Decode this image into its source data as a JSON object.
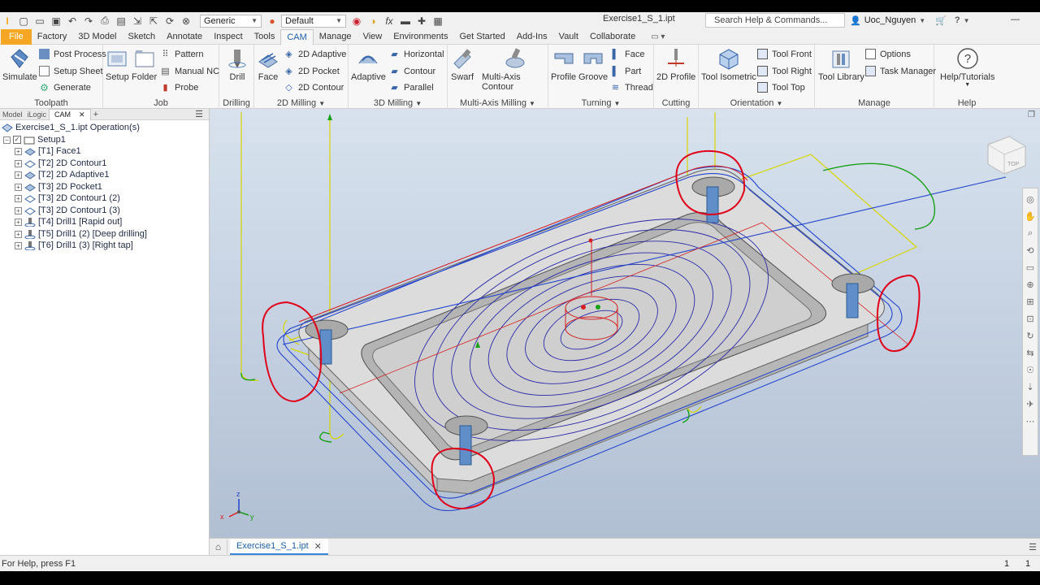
{
  "qat": {
    "material_value": "Generic",
    "appearance_value": "Default",
    "fx_label": "fx",
    "document_title": "Exercise1_S_1.ipt",
    "search_placeholder": "Search Help & Commands...",
    "user_name": "Uoc_Nguyen"
  },
  "menu": {
    "tabs": [
      "File",
      "Factory",
      "3D Model",
      "Sketch",
      "Annotate",
      "Inspect",
      "Tools",
      "CAM",
      "Manage",
      "View",
      "Environments",
      "Get Started",
      "Add-Ins",
      "Vault",
      "Collaborate"
    ],
    "active": "CAM"
  },
  "ribbon": {
    "toolpath": {
      "title": "Toolpath",
      "simulate": "Simulate",
      "post_process": "Post Process",
      "setup_sheet": "Setup Sheet",
      "generate": "Generate"
    },
    "job": {
      "title": "Job",
      "setup": "Setup",
      "folder": "Folder",
      "pattern": "Pattern",
      "manual_nc": "Manual NC",
      "probe": "Probe"
    },
    "drilling": {
      "title": "Drilling",
      "drill": "Drill"
    },
    "milling2d": {
      "title": "2D Milling",
      "face": "Face",
      "adaptive": "2D Adaptive",
      "pocket": "2D Pocket",
      "contour": "2D Contour"
    },
    "milling3d": {
      "title": "3D Milling",
      "adaptive": "Adaptive",
      "horizontal": "Horizontal",
      "contour": "Contour",
      "parallel": "Parallel"
    },
    "multiaxis": {
      "title": "Multi-Axis Milling",
      "swarf": "Swarf",
      "multi_axis_contour": "Multi-Axis Contour"
    },
    "turning": {
      "title": "Turning",
      "profile": "Profile",
      "groove": "Groove",
      "face": "Face",
      "part": "Part",
      "thread": "Thread"
    },
    "cutting": {
      "title": "Cutting",
      "profile2d": "2D Profile"
    },
    "orientation": {
      "title": "Orientation",
      "tool_isometric": "Tool Isometric",
      "tool_front": "Tool Front",
      "tool_right": "Tool Right",
      "tool_top": "Tool Top"
    },
    "manage": {
      "title": "Manage",
      "tool_library": "Tool Library",
      "options": "Options",
      "task_manager": "Task Manager"
    },
    "help": {
      "title": "Help",
      "help_tutorials": "Help/Tutorials"
    }
  },
  "browser": {
    "tabs": [
      "Model",
      "iLogic",
      "CAM"
    ],
    "active_tab": "CAM",
    "root": "Exercise1_S_1.ipt Operation(s)",
    "setup": "Setup1",
    "operations": [
      "[T1] Face1",
      "[T2] 2D Contour1",
      "[T2] 2D Adaptive1",
      "[T3] 2D Pocket1",
      "[T3] 2D Contour1 (2)",
      "[T3] 2D Contour1 (3)",
      "[T4] Drill1 [Rapid out]",
      "[T5] Drill1 (2) [Deep drilling]",
      "[T6] Drill1 (3) [Right tap]"
    ]
  },
  "viewcube": {
    "face_label": "TOP"
  },
  "triad": {
    "x": "x",
    "y": "y",
    "z": "z"
  },
  "doc_tabs": {
    "active": "Exercise1_S_1.ipt"
  },
  "status": {
    "help_text": "For Help, press F1",
    "count1": "1",
    "count2": "1"
  },
  "colors": {
    "accent": "#f5a623",
    "active_tab": "#1b5fa6",
    "markup": "#e0001a"
  }
}
